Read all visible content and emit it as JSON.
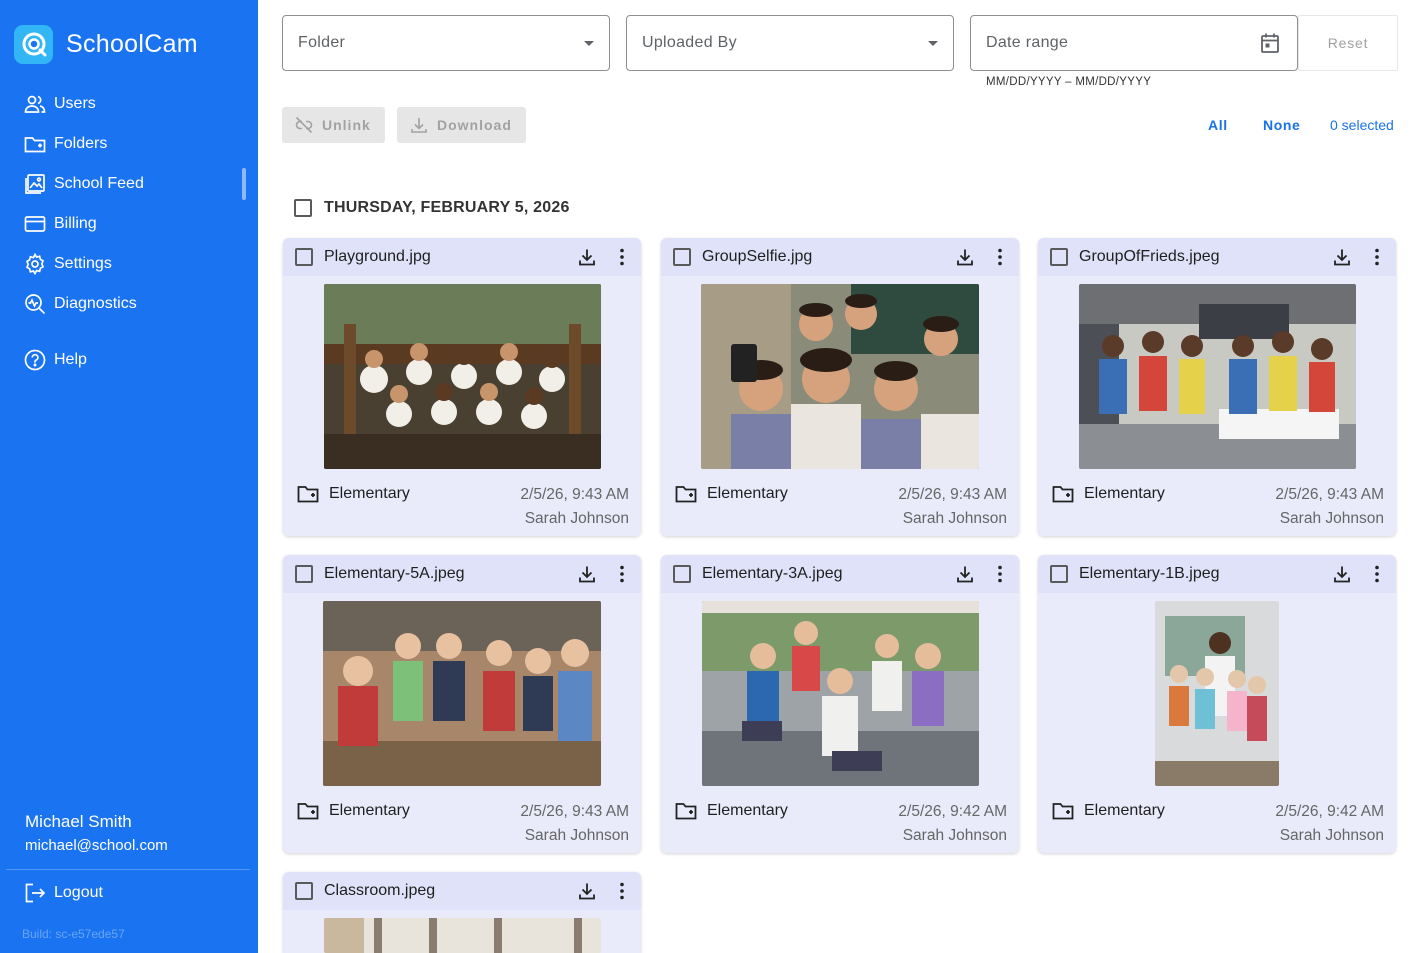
{
  "brand": {
    "name": "SchoolCam"
  },
  "nav": {
    "items": [
      {
        "label": "Users",
        "icon": "users-icon"
      },
      {
        "label": "Folders",
        "icon": "folder-icon"
      },
      {
        "label": "School Feed",
        "icon": "image-feed-icon"
      },
      {
        "label": "Billing",
        "icon": "credit-card-icon"
      },
      {
        "label": "Settings",
        "icon": "gear-icon"
      },
      {
        "label": "Diagnostics",
        "icon": "diagnostics-icon"
      }
    ],
    "help_label": "Help",
    "active": "School Feed"
  },
  "user": {
    "name": "Michael Smith",
    "email": "michael@school.com"
  },
  "logout_label": "Logout",
  "build": "Build: sc-e57ede57",
  "filters": {
    "folder_label": "Folder",
    "uploaded_by_label": "Uploaded By",
    "date_range_label": "Date range",
    "date_format_hint": "MM/DD/YYYY – MM/DD/YYYY",
    "reset_label": "Reset"
  },
  "actions": {
    "unlink_label": "Unlink",
    "download_label": "Download",
    "all_label": "All",
    "none_label": "None",
    "selected_count": "0 selected"
  },
  "feed": {
    "date_heading": "THURSDAY, FEBRUARY 5, 2026",
    "photos": [
      {
        "filename": "Playground.jpg",
        "folder": "Elementary",
        "timestamp": "2/5/26, 9:43 AM",
        "uploaded_by": "Sarah Johnson"
      },
      {
        "filename": "GroupSelfie.jpg",
        "folder": "Elementary",
        "timestamp": "2/5/26, 9:43 AM",
        "uploaded_by": "Sarah Johnson"
      },
      {
        "filename": "GroupOfFrieds.jpeg",
        "folder": "Elementary",
        "timestamp": "2/5/26, 9:43 AM",
        "uploaded_by": "Sarah Johnson"
      },
      {
        "filename": "Elementary-5A.jpeg",
        "folder": "Elementary",
        "timestamp": "2/5/26, 9:43 AM",
        "uploaded_by": "Sarah Johnson"
      },
      {
        "filename": "Elementary-3A.jpeg",
        "folder": "Elementary",
        "timestamp": "2/5/26, 9:42 AM",
        "uploaded_by": "Sarah Johnson"
      },
      {
        "filename": "Elementary-1B.jpeg",
        "folder": "Elementary",
        "timestamp": "2/5/26, 9:42 AM",
        "uploaded_by": "Sarah Johnson"
      },
      {
        "filename": "Classroom.jpeg"
      }
    ]
  },
  "colors": {
    "sidebar": "#1a73f0",
    "accent": "#1a73e8",
    "card": "#e9ebfb",
    "card_header": "#dfe2f8"
  }
}
